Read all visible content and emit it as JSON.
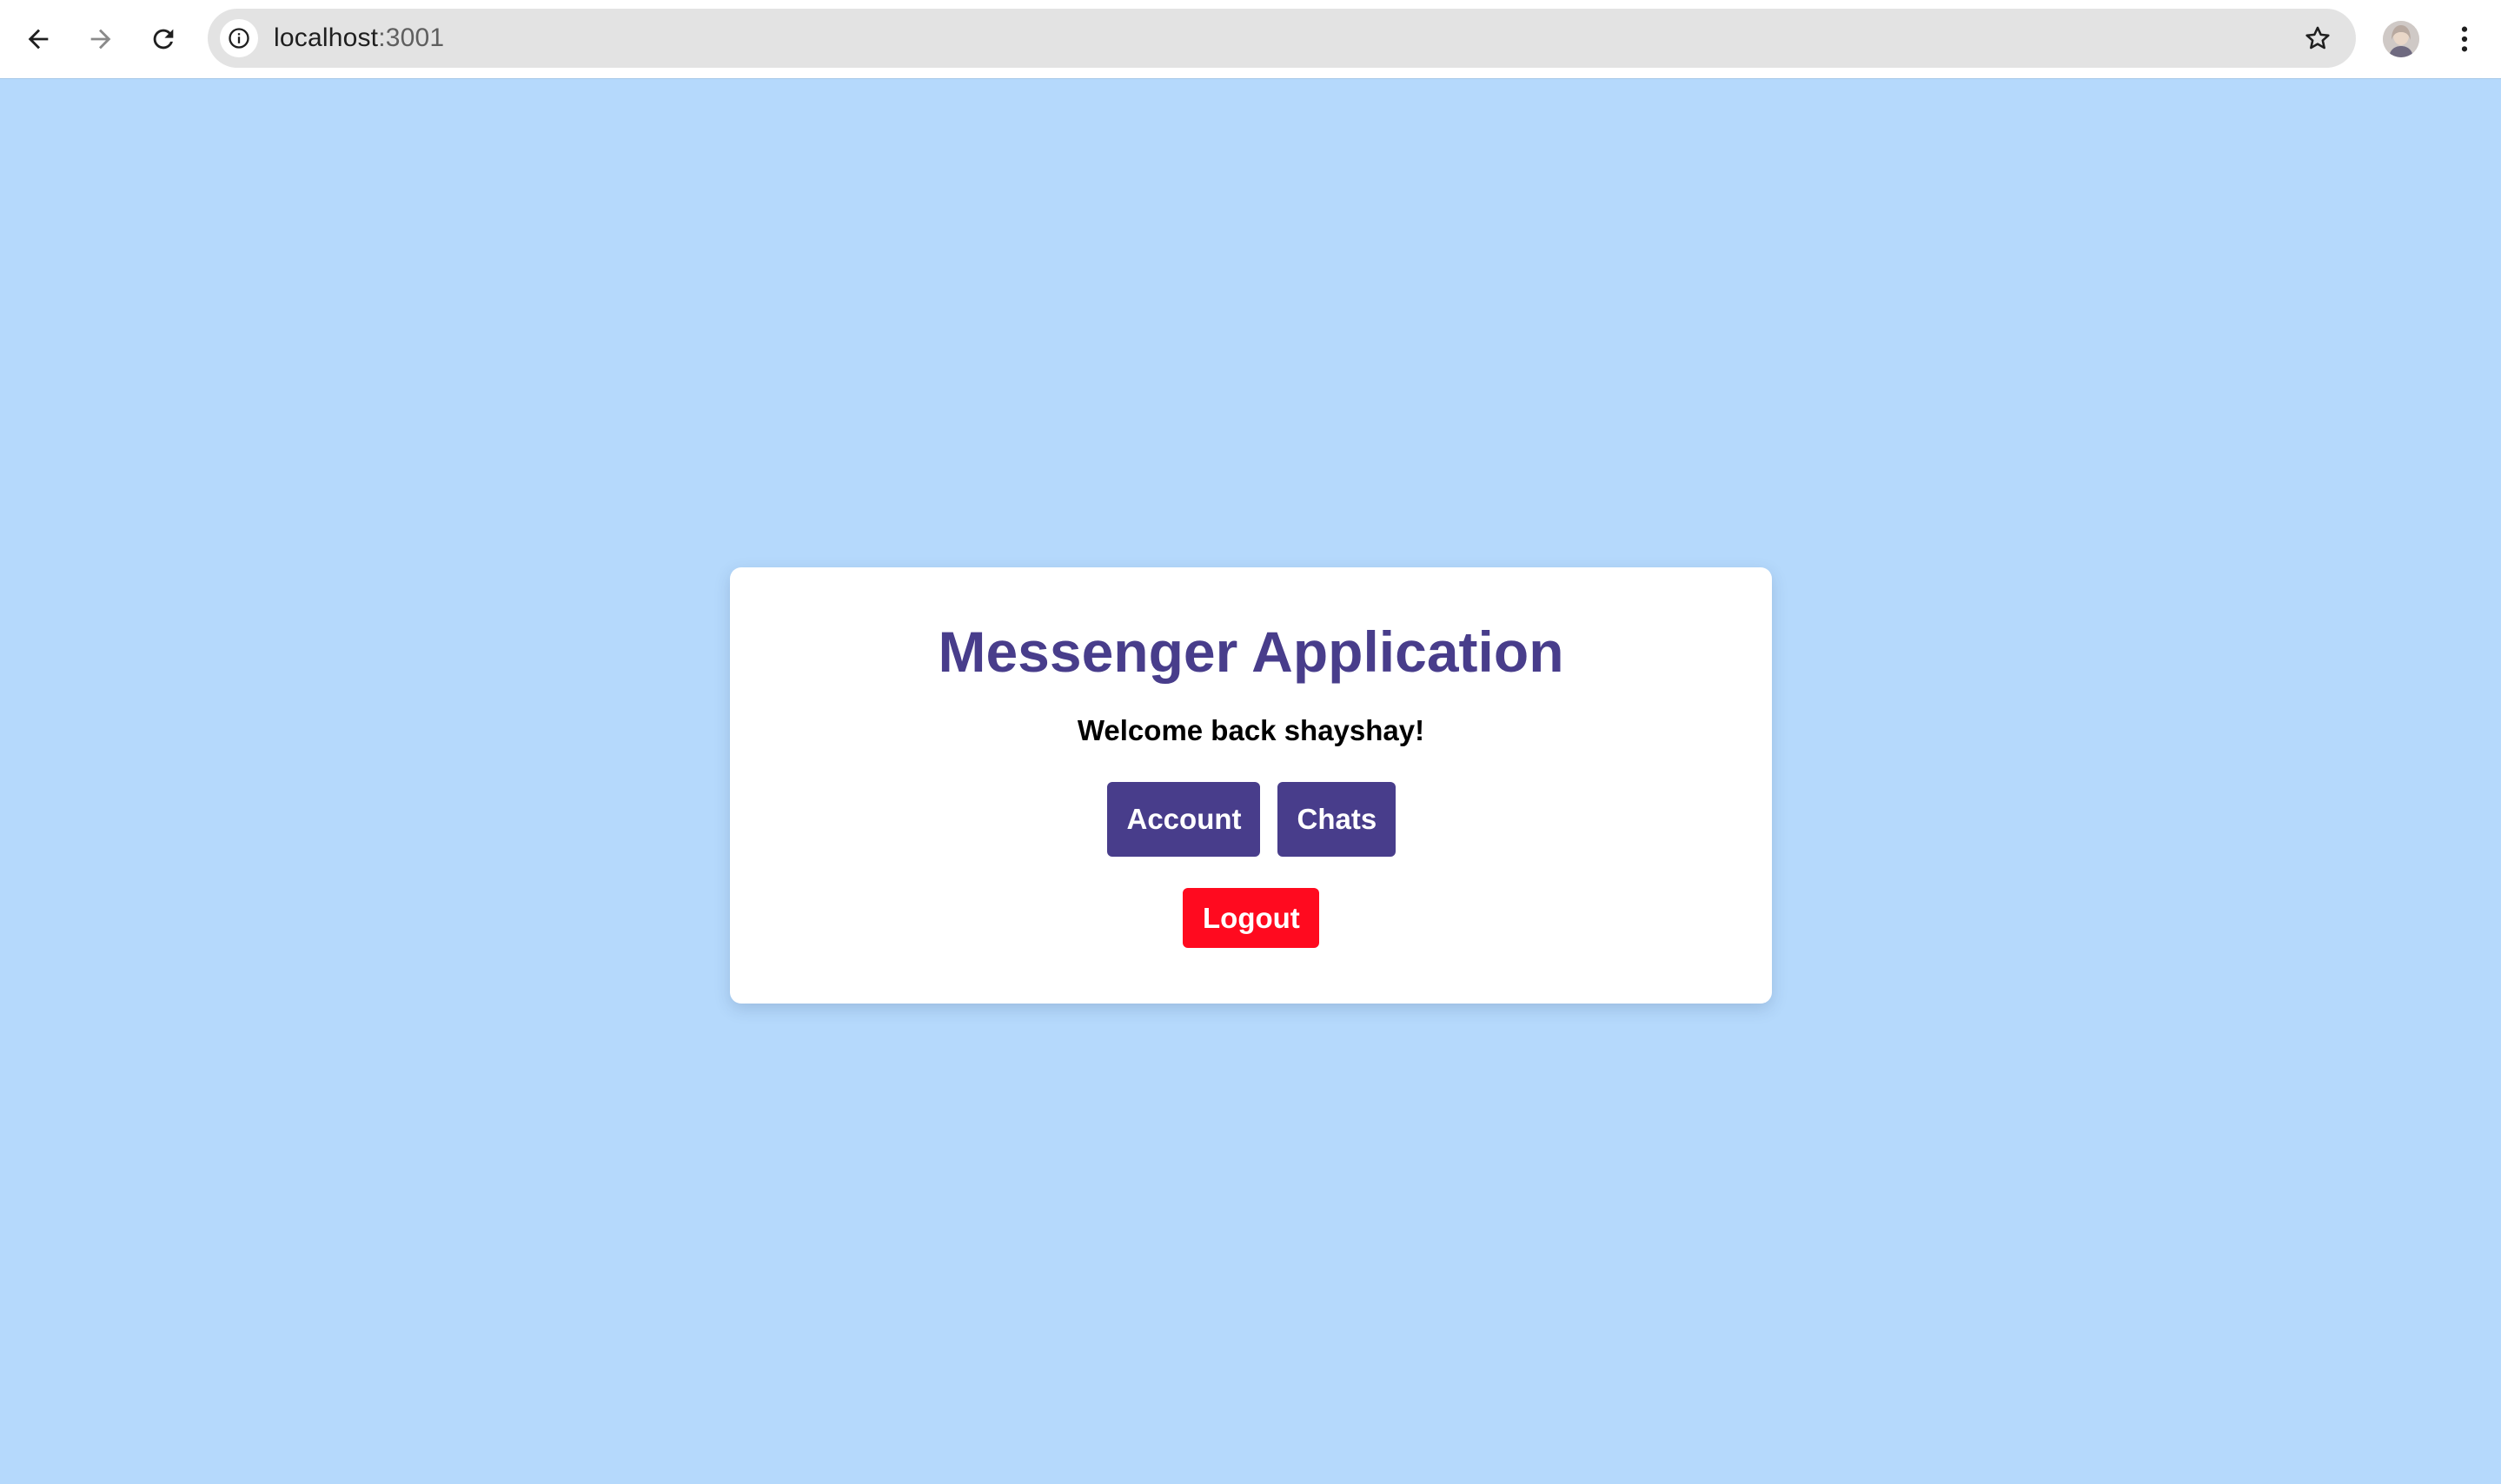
{
  "browser": {
    "url_host": "localhost",
    "url_port": ":3001",
    "icons": {
      "back": "back-arrow-icon",
      "forward": "forward-arrow-icon",
      "reload": "reload-icon",
      "site_info": "info-icon",
      "bookmark": "star-icon",
      "profile": "avatar",
      "menu": "kebab-menu-icon"
    }
  },
  "page": {
    "title": "Messenger Application",
    "welcome": "Welcome back shayshay!",
    "buttons": {
      "account": "Account",
      "chats": "Chats",
      "logout": "Logout"
    }
  },
  "colors": {
    "background": "#b5d9fc",
    "primary": "#483d8b",
    "danger": "#ff0a1f",
    "card": "#ffffff"
  }
}
